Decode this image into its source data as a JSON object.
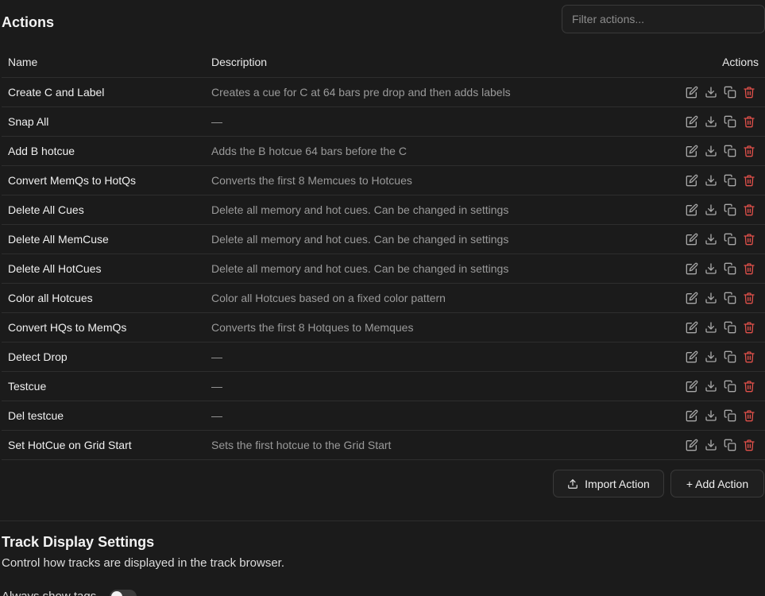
{
  "actions_section": {
    "title": "Actions",
    "filter_placeholder": "Filter actions...",
    "columns": {
      "name": "Name",
      "description": "Description",
      "actions": "Actions"
    },
    "rows": [
      {
        "name": "Create C and Label",
        "description": "Creates a cue for C at 64 bars pre drop and then adds labels"
      },
      {
        "name": "Snap All",
        "description": "—"
      },
      {
        "name": "Add B hotcue",
        "description": "Adds the B hotcue 64 bars before the C"
      },
      {
        "name": "Convert MemQs to HotQs",
        "description": "Converts the first 8 Memcues to Hotcues"
      },
      {
        "name": "Delete All Cues",
        "description": "Delete all memory and hot cues. Can be changed in settings"
      },
      {
        "name": "Delete All MemCuse",
        "description": "Delete all memory and hot cues. Can be changed in settings"
      },
      {
        "name": "Delete All HotCues",
        "description": "Delete all memory and hot cues. Can be changed in settings"
      },
      {
        "name": "Color all Hotcues",
        "description": "Color all Hotcues based on a fixed color pattern"
      },
      {
        "name": "Convert HQs to MemQs",
        "description": "Converts the first 8 Hotques to Memques"
      },
      {
        "name": "Detect Drop",
        "description": "—"
      },
      {
        "name": "Testcue",
        "description": "—"
      },
      {
        "name": "Del testcue",
        "description": "—"
      },
      {
        "name": "Set HotCue on Grid Start",
        "description": "Sets the first hotcue to the Grid Start"
      }
    ],
    "row_action_icons": [
      "edit-icon",
      "download-icon",
      "copy-icon",
      "trash-icon"
    ],
    "import_button_label": "Import Action",
    "add_button_label": "+ Add Action"
  },
  "track_display_section": {
    "title": "Track Display Settings",
    "description": "Control how tracks are displayed in the track browser.",
    "toggle_label": "Always show tags",
    "toggle_on": false
  },
  "colors": {
    "background": "#1b1b1b",
    "text_primary": "#f0f0f0",
    "text_secondary": "#9a9a9a",
    "border": "#2e2e2e",
    "danger": "#e0504a"
  }
}
